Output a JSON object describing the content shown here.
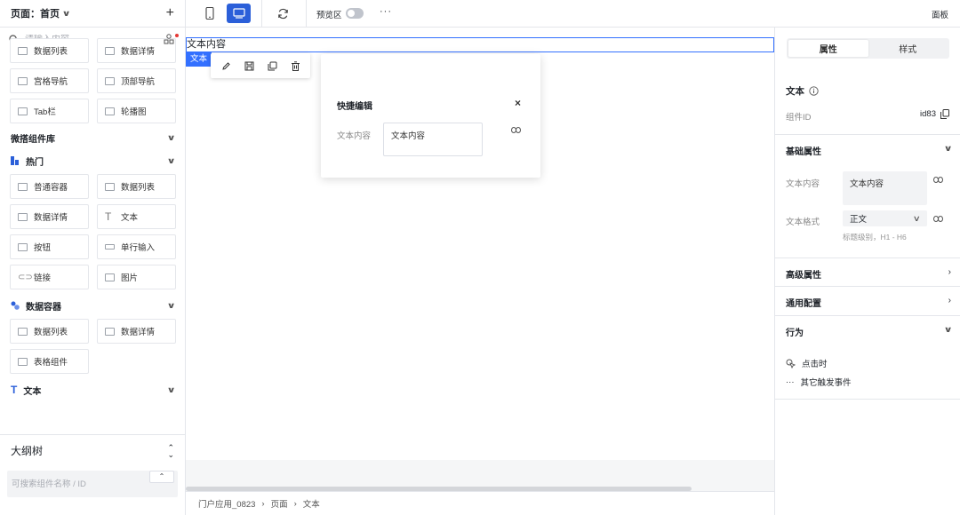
{
  "left_panel": {
    "page_label": "页面：首页",
    "search_placeholder": "请输入内容",
    "top_items": [
      "数据列表",
      "数据详情",
      "宫格导航",
      "顶部导航",
      "Tab栏",
      "轮播图"
    ],
    "library_title": "微搭组件库",
    "groups": [
      {
        "title": "热门",
        "items": [
          "普通容器",
          "数据列表",
          "数据详情",
          "文本",
          "按钮",
          "单行输入",
          "链接",
          "图片"
        ]
      },
      {
        "title": "数据容器",
        "items": [
          "数据列表",
          "数据详情",
          "表格组件"
        ]
      },
      {
        "title": "文本",
        "items": []
      }
    ],
    "outline_title": "大纲树",
    "outline_search_placeholder": "可搜索组件名称 / ID"
  },
  "toolbar": {
    "preview_label": "预览区",
    "more_label": "···",
    "panel_label": "面板"
  },
  "canvas": {
    "text_content": "文本内容",
    "selected_tag": "文本",
    "quick_edit": {
      "title": "快捷编辑",
      "close": "×",
      "field_label": "文本内容",
      "field_value": "文本内容"
    }
  },
  "breadcrumb": [
    "门户应用_0823",
    "页面",
    "文本"
  ],
  "right_panel": {
    "tabs": [
      "属性",
      "样式"
    ],
    "component_name": "文本",
    "component_id_label": "组件ID",
    "component_id": "id83",
    "basic_section": "基础属性",
    "text_content_label": "文本内容",
    "text_content_value": "文本内容",
    "text_format_label": "文本格式",
    "text_format_value": "正文",
    "text_format_hint": "标题级别，H1 - H6",
    "advanced_section": "高级属性",
    "common_section": "通用配置",
    "behavior_section": "行为",
    "on_click": "点击时",
    "other_events": "其它触发事件",
    "more_glyph": "···"
  }
}
